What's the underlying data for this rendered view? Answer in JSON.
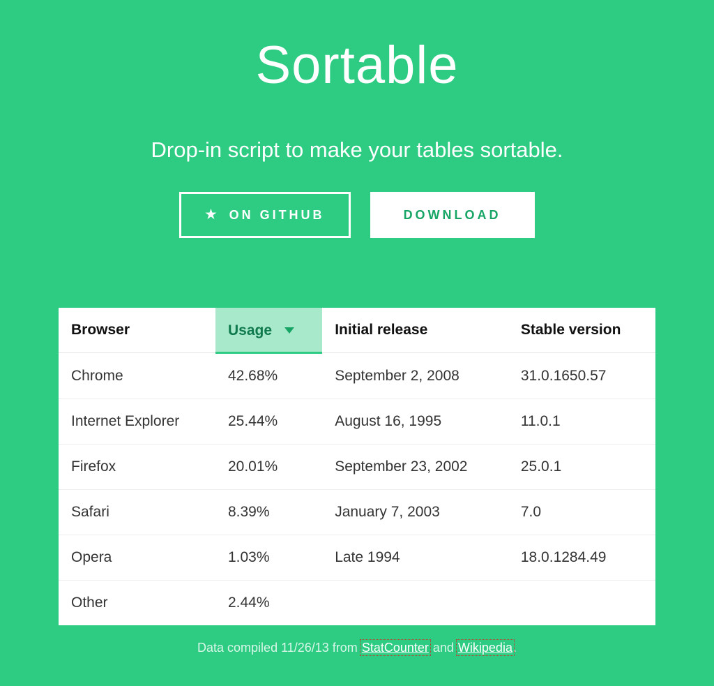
{
  "header": {
    "title": "Sortable",
    "subtitle": "Drop-in script to make your tables sortable."
  },
  "buttons": {
    "github_label": "On GitHub",
    "download_label": "Download"
  },
  "table": {
    "columns": [
      "Browser",
      "Usage",
      "Initial release",
      "Stable version"
    ],
    "sorted_column_index": 1,
    "sort_direction": "desc",
    "rows": [
      {
        "browser": "Chrome",
        "usage": "42.68%",
        "initial_release": "September 2, 2008",
        "stable_version": "31.0.1650.57"
      },
      {
        "browser": "Internet Explorer",
        "usage": "25.44%",
        "initial_release": "August 16, 1995",
        "stable_version": "11.0.1"
      },
      {
        "browser": "Firefox",
        "usage": "20.01%",
        "initial_release": "September 23, 2002",
        "stable_version": "25.0.1"
      },
      {
        "browser": "Safari",
        "usage": "8.39%",
        "initial_release": "January 7, 2003",
        "stable_version": "7.0"
      },
      {
        "browser": "Opera",
        "usage": "1.03%",
        "initial_release": "Late 1994",
        "stable_version": "18.0.1284.49"
      },
      {
        "browser": "Other",
        "usage": "2.44%",
        "initial_release": "",
        "stable_version": ""
      }
    ]
  },
  "footnote": {
    "prefix": "Data compiled 11/26/13 from ",
    "link1_label": "StatCounter",
    "separator": " and ",
    "link2_label": "Wikipedia",
    "suffix": "."
  },
  "colors": {
    "accent": "#2ecc82",
    "sort_highlight_bg": "#a8e8cb",
    "sort_highlight_text": "#0f7a4c"
  }
}
